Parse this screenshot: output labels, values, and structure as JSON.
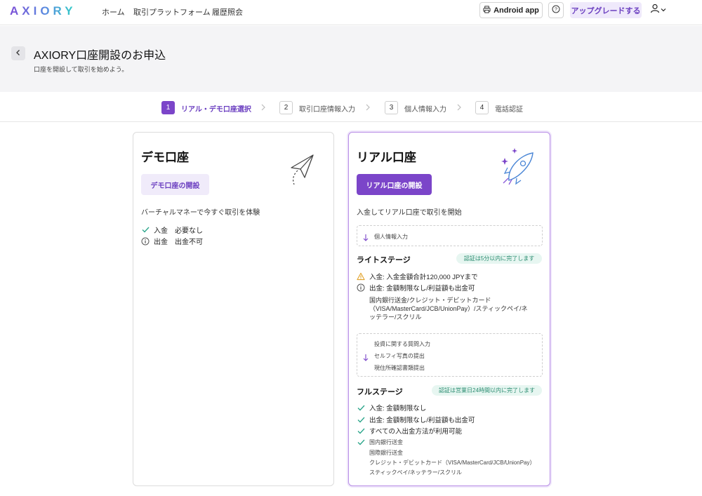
{
  "nav": {
    "logo": "AXIORY",
    "links": [
      "ホーム",
      "取引プラットフォーム",
      "履歴照会"
    ],
    "android_label": "Android app",
    "upgrade_label": "アップグレードする"
  },
  "header": {
    "title": "AXIORY口座開設のお申込",
    "subtitle": "口座を開設して取引を始めよう。"
  },
  "steps": [
    {
      "num": "1",
      "label": "リアル・デモ口座選択"
    },
    {
      "num": "2",
      "label": "取引口座情報入力"
    },
    {
      "num": "3",
      "label": "個人情報入力"
    },
    {
      "num": "4",
      "label": "電話認証"
    }
  ],
  "demo": {
    "title": "デモ口座",
    "button": "デモ口座の開設",
    "description": "バーチャルマネーで今すぐ取引を体験",
    "features": [
      "入金　必要なし",
      "出金　出金不可"
    ]
  },
  "real": {
    "title": "リアル口座",
    "button": "リアル口座の開設",
    "description": "入金してリアル口座で取引を開始",
    "step_box1": "個人情報入力",
    "lite": {
      "title": "ライトステージ",
      "badge": "認証は5分以内に完了します",
      "deposit": "入金: 入金金額合計120,000 JPYまで",
      "withdraw": "出金: 金額制限なし/利益額も出金可",
      "methods": [
        "国内銀行送金/クレジット・デビットカード",
        "（VISA/MasterCard/JCB/UnionPay）/スティックペイ/ネ",
        "ッテラー/スクリル"
      ]
    },
    "step_box2": [
      "投資に関する質問入力",
      "セルフィ写真の提出",
      "現住所確認書類提出"
    ],
    "full": {
      "title": "フルステージ",
      "badge": "認証は営業日24時間以内に完了します",
      "deposit": "入金: 金額制限なし",
      "withdraw": "出金: 金額制限なし/利益額も出金可",
      "all_methods": "すべての入出金方法が利用可能",
      "methods": [
        "国内銀行送金",
        "国際銀行送金",
        "クレジット・デビットカード（VISA/MasterCard/JCB/UnionPay）",
        "スティックペイ/ネッテラー/スクリル"
      ]
    }
  },
  "colors": {
    "accent": "#7b45c9",
    "accent_light": "#f0ebfa",
    "badge_bg": "#e7f6f1",
    "badge_text": "#2a8c70",
    "check": "#2aa58a",
    "warn": "#e2a32b"
  }
}
